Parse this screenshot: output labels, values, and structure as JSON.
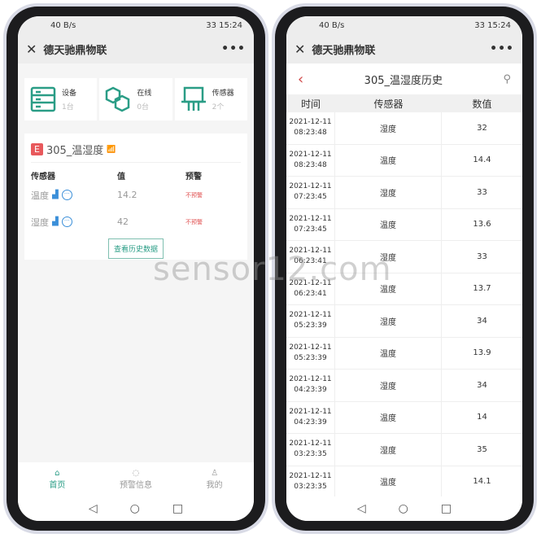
{
  "status": {
    "time": "15:24",
    "speed": "40 B/s",
    "battery": "33"
  },
  "app_title": "德天驰鼎物联",
  "left": {
    "stats": [
      {
        "label": "设备",
        "count": "1台",
        "icon": "server-icon"
      },
      {
        "label": "在线",
        "count": "0台",
        "icon": "link-hexagon-icon"
      },
      {
        "label": "传感器",
        "count": "2个",
        "icon": "sensor-icon"
      }
    ],
    "device": {
      "badge": "E",
      "name": "305_温湿度"
    },
    "columns": [
      "传感器",
      "值",
      "预警"
    ],
    "sensors": [
      {
        "name": "温度",
        "value": "14.2",
        "warning": "不预警"
      },
      {
        "name": "湿度",
        "value": "42",
        "warning": "不预警"
      }
    ],
    "history_button": "查看历史数据",
    "tabs": [
      {
        "label": "首页",
        "icon": "home-icon"
      },
      {
        "label": "预警信息",
        "icon": "chat-icon"
      },
      {
        "label": "我的",
        "icon": "user-icon"
      }
    ]
  },
  "right": {
    "title": "305_温湿度历史",
    "columns": [
      "时间",
      "传感器",
      "数值"
    ],
    "rows": [
      {
        "date": "2021-12-11",
        "time": "08:23:48",
        "sensor": "湿度",
        "value": "32"
      },
      {
        "date": "2021-12-11",
        "time": "08:23:48",
        "sensor": "温度",
        "value": "14.4"
      },
      {
        "date": "2021-12-11",
        "time": "07:23:45",
        "sensor": "湿度",
        "value": "33"
      },
      {
        "date": "2021-12-11",
        "time": "07:23:45",
        "sensor": "温度",
        "value": "13.6"
      },
      {
        "date": "2021-12-11",
        "time": "06:23:41",
        "sensor": "湿度",
        "value": "33"
      },
      {
        "date": "2021-12-11",
        "time": "06:23:41",
        "sensor": "温度",
        "value": "13.7"
      },
      {
        "date": "2021-12-11",
        "time": "05:23:39",
        "sensor": "湿度",
        "value": "34"
      },
      {
        "date": "2021-12-11",
        "time": "05:23:39",
        "sensor": "温度",
        "value": "13.9"
      },
      {
        "date": "2021-12-11",
        "time": "04:23:39",
        "sensor": "湿度",
        "value": "34"
      },
      {
        "date": "2021-12-11",
        "time": "04:23:39",
        "sensor": "温度",
        "value": "14"
      },
      {
        "date": "2021-12-11",
        "time": "03:23:35",
        "sensor": "湿度",
        "value": "35"
      },
      {
        "date": "2021-12-11",
        "time": "03:23:35",
        "sensor": "温度",
        "value": "14.1"
      }
    ]
  },
  "watermark": "sensor12.com",
  "colors": {
    "accent": "#2a9d86",
    "warning": "#e05050",
    "badge": "#e8595c"
  }
}
